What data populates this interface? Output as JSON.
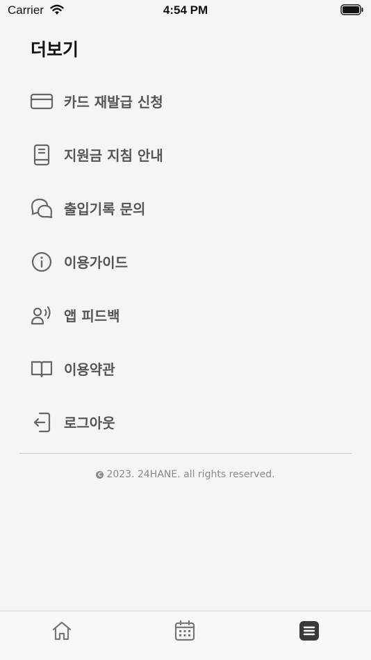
{
  "status": {
    "carrier": "Carrier",
    "time": "4:54 PM"
  },
  "page": {
    "title": "더보기"
  },
  "menu": {
    "items": [
      {
        "label": "카드 재발급 신청",
        "icon": "credit-card-icon"
      },
      {
        "label": "지원금 지침 안내",
        "icon": "book-icon"
      },
      {
        "label": "출입기록 문의",
        "icon": "chat-bubbles-icon"
      },
      {
        "label": "이용가이드",
        "icon": "info-icon"
      },
      {
        "label": "앱 피드백",
        "icon": "voice-feedback-icon"
      },
      {
        "label": "이용약관",
        "icon": "open-book-icon"
      },
      {
        "label": "로그아웃",
        "icon": "logout-icon"
      }
    ]
  },
  "footer": {
    "copyright": "2023. 24HANE. all rights reserved."
  },
  "tabbar": {
    "tabs": [
      {
        "name": "home",
        "icon": "home-icon",
        "active": false
      },
      {
        "name": "calendar",
        "icon": "calendar-icon",
        "active": false
      },
      {
        "name": "more",
        "icon": "menu-icon",
        "active": true
      }
    ]
  },
  "colors": {
    "background": "#f5f5f5",
    "icon": "#666666",
    "label": "#555555",
    "active_tab": "#3a3a3a"
  }
}
